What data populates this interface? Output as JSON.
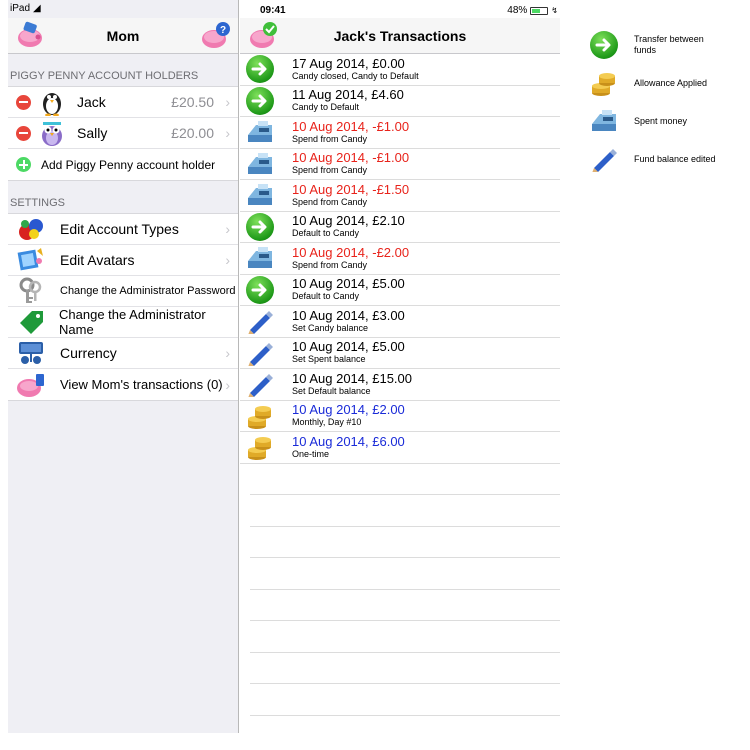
{
  "status": {
    "device": "iPad",
    "time": "09:41",
    "battery": "48%"
  },
  "left": {
    "title": "Mom",
    "holders_header": "PIGGY PENNY ACCOUNT HOLDERS",
    "holders": [
      {
        "name": "Jack",
        "amount": "£20.50",
        "avatar": "penguin-avatar"
      },
      {
        "name": "Sally",
        "amount": "£20.00",
        "avatar": "owl-avatar"
      }
    ],
    "add_holder": "Add Piggy Penny account holder",
    "settings_header": "SETTINGS",
    "settings": [
      {
        "label": "Edit Account Types",
        "icon": "balls-icon",
        "chevron": true,
        "small": false
      },
      {
        "label": "Edit Avatars",
        "icon": "avatars-icon",
        "chevron": true,
        "small": false
      },
      {
        "label": "Change the Administrator Password",
        "icon": "keys-icon",
        "chevron": false,
        "small": true
      },
      {
        "label": "Change the Administrator Name",
        "icon": "tag-icon",
        "chevron": false,
        "small": false
      },
      {
        "label": "Currency",
        "icon": "currency-icon",
        "chevron": true,
        "small": false
      },
      {
        "label": "View Mom's transactions (0)",
        "icon": "piggy-icon",
        "chevron": true,
        "small": false
      }
    ]
  },
  "right": {
    "title": "Jack's Transactions",
    "transactions": [
      {
        "type": "transfer",
        "main": "17 Aug 2014, £0.00",
        "sub": "Candy closed, Candy to Default"
      },
      {
        "type": "transfer",
        "main": "11 Aug 2014, £4.60",
        "sub": "Candy to Default"
      },
      {
        "type": "spent",
        "main": "10 Aug 2014, -£1.00",
        "sub": "Spend from Candy"
      },
      {
        "type": "spent",
        "main": "10 Aug 2014, -£1.00",
        "sub": "Spend from Candy"
      },
      {
        "type": "spent",
        "main": "10 Aug 2014, -£1.50",
        "sub": "Spend from Candy"
      },
      {
        "type": "transfer",
        "main": "10 Aug 2014, £2.10",
        "sub": "Default to Candy"
      },
      {
        "type": "spent",
        "main": "10 Aug 2014, -£2.00",
        "sub": "Spend from Candy"
      },
      {
        "type": "transfer",
        "main": "10 Aug 2014, £5.00",
        "sub": "Default to Candy"
      },
      {
        "type": "edit",
        "main": "10 Aug 2014, £3.00",
        "sub": "Set Candy balance"
      },
      {
        "type": "edit",
        "main": "10 Aug 2014, £5.00",
        "sub": "Set Spent balance"
      },
      {
        "type": "edit",
        "main": "10 Aug 2014, £15.00",
        "sub": "Set Default balance"
      },
      {
        "type": "allowance",
        "main": "10 Aug 2014, £2.00",
        "sub": "Monthly, Day #10"
      },
      {
        "type": "allowance",
        "main": "10 Aug 2014, £6.00",
        "sub": "One-time"
      }
    ]
  },
  "legend": [
    {
      "type": "transfer",
      "label": "Transfer between funds"
    },
    {
      "type": "allowance",
      "label": "Allowance Applied"
    },
    {
      "type": "spent",
      "label": "Spent money"
    },
    {
      "type": "edit",
      "label": "Fund balance edited"
    }
  ],
  "colors": {
    "negative": "#e8231b",
    "allowance": "#1a2bd8",
    "minus": "#e8463b",
    "plus": "#4cd964"
  }
}
